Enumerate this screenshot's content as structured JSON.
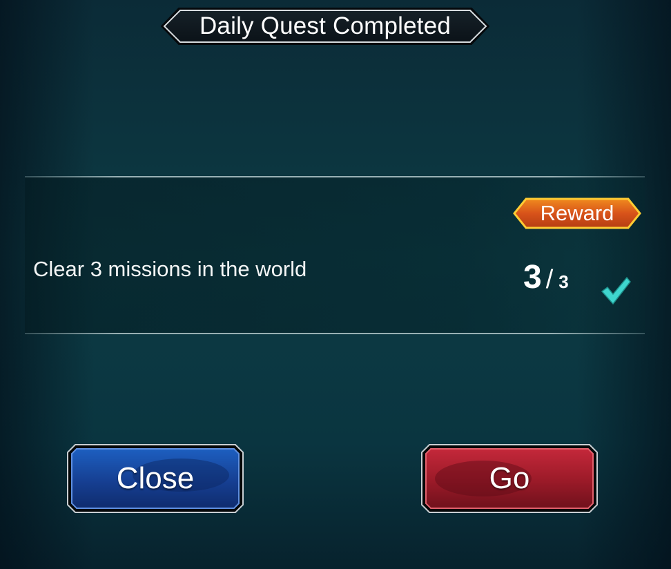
{
  "dialog": {
    "title": "Daily Quest Completed"
  },
  "quest": {
    "description": "Clear 3 missions in the world",
    "reward_label": "Reward",
    "progress_current": "3",
    "progress_separator": "/",
    "progress_total": "3",
    "status_icon": "checkmark-icon"
  },
  "buttons": {
    "close_label": "Close",
    "go_label": "Go"
  },
  "colors": {
    "background": "#0d3b44",
    "reward_orange": "#e0661a",
    "check_teal": "#3fd6cf",
    "close_blue": "#1c4fa8",
    "go_red": "#a81c2a"
  }
}
